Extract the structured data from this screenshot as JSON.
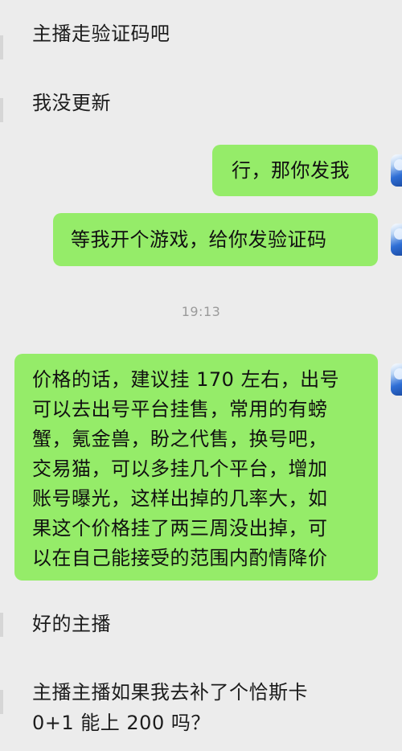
{
  "messages": [
    {
      "side": "left",
      "text": "主播走验证码吧"
    },
    {
      "side": "left",
      "text": "我没更新"
    },
    {
      "side": "right",
      "text": "行，那你发我"
    },
    {
      "side": "right",
      "text": "等我开个游戏，给你发验证码"
    },
    {
      "side": "right",
      "lines": [
        "价格的话，建议挂 170 左右，出号",
        "可以去出号平台挂售，常用的有螃",
        "蟹，氪金兽，盼之代售，换号吧，",
        "交易猫，可以多挂几个平台，增加",
        "账号曝光，这样出掉的几率大，如",
        "果这个价格挂了两三周没出掉，可",
        "以在自己能接受的范围内酌情降价"
      ]
    },
    {
      "side": "left",
      "text": "好的主播"
    },
    {
      "side": "left",
      "lines": [
        "主播主播如果我去补了个恰斯卡",
        "0+1 能上 200 吗？"
      ]
    }
  ],
  "timestamp": "19:13",
  "colors": {
    "background": "#ececec",
    "bubble_self": "#95ec69",
    "timestamp_text": "#9a9a9a"
  },
  "icons": [
    "avatar-icon"
  ]
}
